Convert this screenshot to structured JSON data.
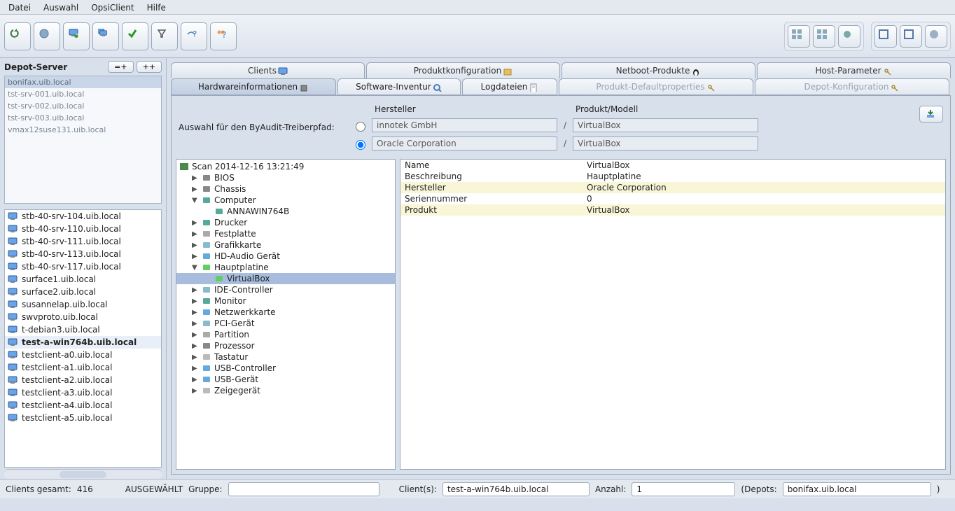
{
  "menu": {
    "items": [
      "Datei",
      "Auswahl",
      "OpsiClient",
      "Hilfe"
    ]
  },
  "left": {
    "title": "Depot-Server",
    "btn_eq": "=+",
    "btn_pp": "++",
    "depots": [
      {
        "name": "bonifax.uib.local",
        "selected": true
      },
      {
        "name": "tst-srv-001.uib.local"
      },
      {
        "name": "tst-srv-002.uib.local"
      },
      {
        "name": "tst-srv-003.uib.local"
      },
      {
        "name": "vmax12suse131.uib.local"
      }
    ],
    "clients": [
      {
        "name": "stb-40-srv-104.uib.local"
      },
      {
        "name": "stb-40-srv-110.uib.local"
      },
      {
        "name": "stb-40-srv-111.uib.local"
      },
      {
        "name": "stb-40-srv-113.uib.local"
      },
      {
        "name": "stb-40-srv-117.uib.local"
      },
      {
        "name": "surface1.uib.local"
      },
      {
        "name": "surface2.uib.local"
      },
      {
        "name": "susannelap.uib.local"
      },
      {
        "name": "swvproto.uib.local"
      },
      {
        "name": "t-debian3.uib.local"
      },
      {
        "name": "test-a-win764b.uib.local",
        "selected": true
      },
      {
        "name": "testclient-a0.uib.local"
      },
      {
        "name": "testclient-a1.uib.local"
      },
      {
        "name": "testclient-a2.uib.local"
      },
      {
        "name": "testclient-a3.uib.local"
      },
      {
        "name": "testclient-a4.uib.local"
      },
      {
        "name": "testclient-a5.uib.local"
      }
    ]
  },
  "maintabs": [
    {
      "label": "Clients"
    },
    {
      "label": "Produktkonfiguration"
    },
    {
      "label": "Netboot-Produkte"
    },
    {
      "label": "Host-Parameter"
    }
  ],
  "subtabs": [
    {
      "label": "Hardwareinformationen",
      "active": true
    },
    {
      "label": "Software-Inventur"
    },
    {
      "label": "Logdateien"
    },
    {
      "label": "Produkt-Defaultproperties",
      "dim": true
    },
    {
      "label": "Depot-Konfiguration",
      "dim": true
    }
  ],
  "audit": {
    "label": "Auswahl für den ByAudit-Treiberpfad:",
    "h_vendor": "Hersteller",
    "h_model": "Produkt/Modell",
    "rows": [
      {
        "vendor": "innotek GmbH",
        "model": "VirtualBox",
        "checked": false
      },
      {
        "vendor": "Oracle Corporation",
        "model": "VirtualBox",
        "checked": true
      }
    ]
  },
  "tree": {
    "root": "Scan 2014-12-16 13:21:49",
    "nodes": [
      {
        "label": "BIOS",
        "glyph": "chip",
        "exp": false,
        "indent": 1
      },
      {
        "label": "Chassis",
        "glyph": "chip",
        "exp": false,
        "indent": 1
      },
      {
        "label": "Computer",
        "glyph": "monitor",
        "exp": true,
        "indent": 1
      },
      {
        "label": "ANNAWIN764B",
        "glyph": "monitor",
        "indent": 2,
        "leaf": true
      },
      {
        "label": "Drucker",
        "glyph": "printer",
        "exp": false,
        "indent": 1
      },
      {
        "label": "Festplatte",
        "glyph": "disk",
        "exp": false,
        "indent": 1
      },
      {
        "label": "Grafikkarte",
        "glyph": "card",
        "exp": false,
        "indent": 1
      },
      {
        "label": "HD-Audio Gerät",
        "glyph": "audio",
        "exp": false,
        "indent": 1
      },
      {
        "label": "Hauptplatine",
        "glyph": "board",
        "exp": true,
        "indent": 1
      },
      {
        "label": "VirtualBox",
        "glyph": "board",
        "indent": 2,
        "leaf": true,
        "selected": true
      },
      {
        "label": "IDE-Controller",
        "glyph": "card",
        "exp": false,
        "indent": 1
      },
      {
        "label": "Monitor",
        "glyph": "monitor",
        "exp": false,
        "indent": 1
      },
      {
        "label": "Netzwerkkarte",
        "glyph": "net",
        "exp": false,
        "indent": 1
      },
      {
        "label": "PCI-Gerät",
        "glyph": "card",
        "exp": false,
        "indent": 1
      },
      {
        "label": "Partition",
        "glyph": "disk",
        "exp": false,
        "indent": 1
      },
      {
        "label": "Prozessor",
        "glyph": "chip",
        "exp": false,
        "indent": 1
      },
      {
        "label": "Tastatur",
        "glyph": "keyboard",
        "exp": false,
        "indent": 1
      },
      {
        "label": "USB-Controller",
        "glyph": "usb",
        "exp": false,
        "indent": 1
      },
      {
        "label": "USB-Gerät",
        "glyph": "usb",
        "exp": false,
        "indent": 1
      },
      {
        "label": "Zeigegerät",
        "glyph": "mouse",
        "exp": false,
        "indent": 1
      }
    ]
  },
  "details": [
    {
      "k": "Name",
      "v": "VirtualBox",
      "alt": false
    },
    {
      "k": "Beschreibung",
      "v": "Hauptplatine",
      "alt": true
    },
    {
      "k": "Hersteller",
      "v": "Oracle Corporation",
      "alt": false,
      "hl": true
    },
    {
      "k": "Seriennummer",
      "v": "0",
      "alt": true
    },
    {
      "k": "Produkt",
      "v": "VirtualBox",
      "alt": false,
      "hl": true
    }
  ],
  "status": {
    "clients_total_label": "Clients gesamt:",
    "clients_total": "416",
    "selected_label": "AUSGEWÄHLT",
    "group_label": "Gruppe:",
    "group_value": "",
    "clients_label": "Client(s):",
    "clients_value": "test-a-win764b.uib.local",
    "count_label": "Anzahl:",
    "count_value": "1",
    "depots_label": "(Depots:",
    "depots_value": "bonifax.uib.local"
  }
}
